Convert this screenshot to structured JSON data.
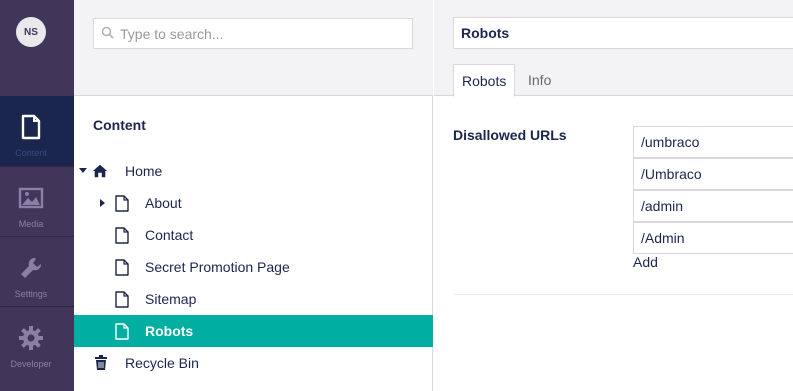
{
  "user": {
    "initials": "NS"
  },
  "sections": [
    {
      "label": "Content",
      "icon": "document-icon",
      "active": true
    },
    {
      "label": "Media",
      "icon": "image-icon",
      "active": false
    },
    {
      "label": "Settings",
      "icon": "wrench-icon",
      "active": false
    },
    {
      "label": "Developer",
      "icon": "gear-icon",
      "active": false
    }
  ],
  "search": {
    "placeholder": "Type to search..."
  },
  "tree": {
    "title": "Content",
    "nodes": [
      {
        "label": "Home",
        "icon": "home-icon",
        "expanded": true
      },
      {
        "label": "About",
        "icon": "document-icon",
        "has_children": true
      },
      {
        "label": "Contact",
        "icon": "document-icon"
      },
      {
        "label": "Secret Promotion Page",
        "icon": "document-icon"
      },
      {
        "label": "Sitemap",
        "icon": "document-icon"
      },
      {
        "label": "Robots",
        "icon": "document-icon",
        "selected": true
      },
      {
        "label": "Recycle Bin",
        "icon": "trash-icon"
      }
    ]
  },
  "editor": {
    "name_value": "Robots",
    "tabs": [
      {
        "label": "Robots",
        "active": true
      },
      {
        "label": "Info",
        "active": false
      }
    ],
    "property": {
      "label": "Disallowed URLs",
      "values": [
        "/umbraco",
        "/Umbraco",
        "/admin",
        "/Admin"
      ],
      "add_label": "Add"
    }
  },
  "colors": {
    "sections_bg": "#413659",
    "active_section_bg": "#1b264f",
    "selected_node_bg": "#00aea2",
    "text": "#1b264f"
  }
}
